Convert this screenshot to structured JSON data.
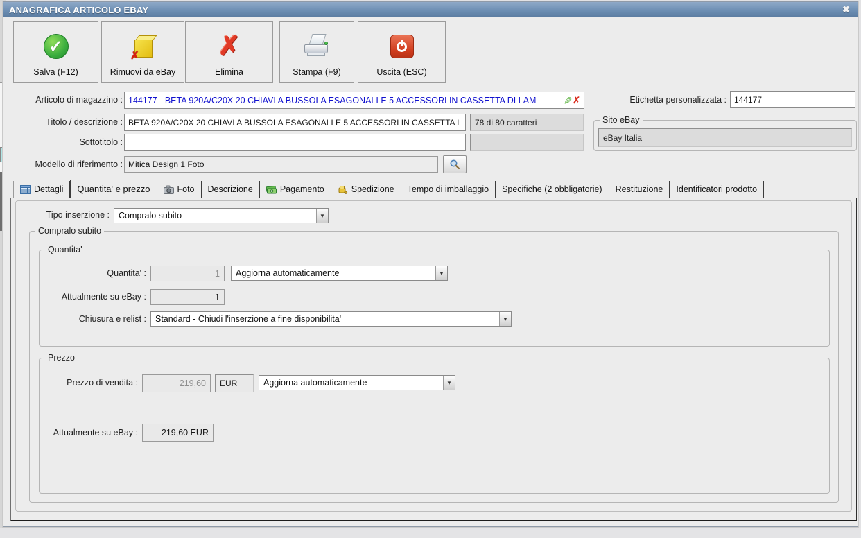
{
  "window": {
    "title": "ANAGRAFICA ARTICOLO EBAY",
    "close_glyph": "✖"
  },
  "toolbar": {
    "buttons": [
      {
        "label": "Salva (F12)",
        "icon": "save-check-icon"
      },
      {
        "label": "Rimuovi da eBay",
        "icon": "remove-from-ebay-icon"
      },
      {
        "label": "Elimina",
        "icon": "delete-x-icon"
      },
      {
        "label": "Stampa (F9)",
        "icon": "printer-icon"
      },
      {
        "label": "Uscita (ESC)",
        "icon": "power-exit-icon"
      }
    ],
    "check_glyph": "✓",
    "x_glyph": "✗"
  },
  "form": {
    "articolo": {
      "label": "Articolo di magazzino :",
      "value": "144177 - BETA 920A/C20X 20 CHIAVI A BUSSOLA ESAGONALI E 5 ACCESSORI IN CASSETTA DI LAM",
      "edit_glyph": "✎",
      "clear_glyph": "✗"
    },
    "titolo": {
      "label": "Titolo / descrizione :",
      "value": "BETA 920A/C20X 20 CHIAVI A BUSSOLA ESAGONALI E 5 ACCESSORI IN CASSETTA L",
      "counter": "78 di 80 caratteri"
    },
    "sottotitolo": {
      "label": "Sottotitolo :",
      "value": ""
    },
    "modello": {
      "label": "Modello di riferimento :",
      "value": "Mitica Design 1 Foto"
    },
    "etichetta": {
      "label": "Etichetta personalizzata :",
      "value": "144177"
    },
    "sito": {
      "group_label": "Sito eBay",
      "value": "eBay Italia"
    }
  },
  "tabs": [
    {
      "label": "Dettagli"
    },
    {
      "label": "Quantita' e prezzo"
    },
    {
      "label": "Foto"
    },
    {
      "label": "Descrizione"
    },
    {
      "label": "Pagamento"
    },
    {
      "label": "Spedizione"
    },
    {
      "label": "Tempo di imballaggio"
    },
    {
      "label": "Specifiche (2 obbligatorie)"
    },
    {
      "label": "Restituzione"
    },
    {
      "label": "Identificatori prodotto"
    }
  ],
  "panel": {
    "tipo_label": "Tipo inserzione :",
    "tipo_value": "Compralo subito",
    "group_label": "Compralo subito",
    "quantita": {
      "group_label": "Quantita'",
      "qty_label": "Quantita' :",
      "qty_value": "1",
      "qty_mode": "Aggiorna automaticamente",
      "ebay_label": "Attualmente su eBay :",
      "ebay_value": "1",
      "relist_label": "Chiusura e relist :",
      "relist_value": "Standard - Chiudi l'inserzione a fine disponibilita'"
    },
    "prezzo": {
      "group_label": "Prezzo",
      "price_label": "Prezzo di vendita :",
      "price_value": "219,60",
      "currency": "EUR",
      "price_mode": "Aggiorna automaticamente",
      "ebay_label": "Attualmente su eBay :",
      "ebay_value": "219,60 EUR"
    },
    "dropdown_glyph": "▼"
  },
  "colors": {
    "titlebar_blue": "#6d8fb4",
    "link_blue": "#1212cf",
    "alert_red": "#d92b1c",
    "ok_green": "#3cae3f",
    "ebay_yellow": "#e3bd12"
  }
}
